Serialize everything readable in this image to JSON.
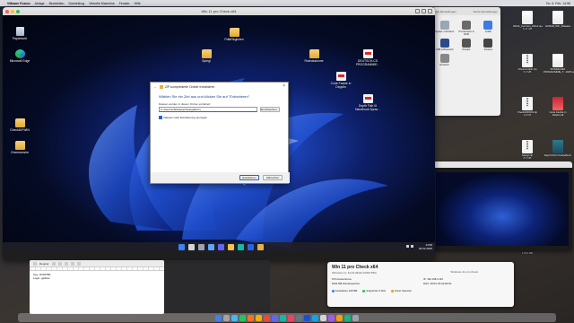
{
  "menubar": {
    "app": "VMware Fusion",
    "items": [
      "Ablage",
      "Bearbeiten",
      "Darstellung",
      "Virtuelle Maschine",
      "Fenster",
      "Hilfe"
    ],
    "clock": "Do. 6. Feb. 14:56"
  },
  "vm": {
    "title": "Win 11 pro Check x64",
    "desktop_icons": [
      {
        "label": "Papierkorb",
        "type": "bin"
      },
      {
        "label": "Microsoft Edge",
        "type": "edge"
      },
      {
        "label": "CheckDIFWIN",
        "type": "folder"
      },
      {
        "label": "Cheemzeshe",
        "type": "folder"
      },
      {
        "label": "PdfaRegisiren",
        "type": "folder"
      },
      {
        "label": "Spiegl",
        "type": "folder"
      },
      {
        "label": "Rubrokalonne",
        "type": "folder"
      },
      {
        "label": "DEUTSCH-CS PROGRAMMIE...",
        "type": "pdf"
      },
      {
        "label": "Code Fackte in Depplin",
        "type": "pdf"
      },
      {
        "label": "Depth Fish III Handbook Sprac...",
        "type": "pdf"
      }
    ],
    "taskbar_time": "14:56",
    "taskbar_date": "06.02.2025"
  },
  "zip_dialog": {
    "window_title": "ZIP-komprimierte Ordner extrahieren",
    "heading": "Wählen Sie ein Ziel aus und klicken Sie auf \"Extrahieren\".",
    "label": "Dateien werden in diesen Ordner extrahiert:",
    "path_value": "C:\\Users\\Gl\\Desktop\\Spiegelkorrs",
    "browse_label": "Durchsuchen...",
    "checkbox_label": "Dateien nach Extrahierung anzeigen",
    "extract_label": "Extrahieren",
    "cancel_label": "Abbrechen"
  },
  "prefs": {
    "header_left": "Alle Einstellungen",
    "header_right": "Suche Einstellungen",
    "items": [
      "Syntax- und Menü",
      "Prozessoren & RAM",
      "Grafik",
      "USB & Bluetooth",
      "Drucker",
      "Kamera",
      "Erweitert"
    ]
  },
  "mac_files": [
    {
      "name": "Win11_German_x64v1.iso",
      "sub": "5,47 GB"
    },
    {
      "name": "SONAR_Win_Release",
      "sub": ""
    },
    {
      "name": "Chemcombin.zip",
      "sub": "5,3 MB"
    },
    {
      "name": "SONAR-DEX PROGRAMMIE_T...2025.pdf",
      "sub": ""
    },
    {
      "name": "CheckDIFWIN.zip",
      "sub": "9,8 KB"
    },
    {
      "name": "Code Fackte in Delphi.pdf",
      "sub": ""
    },
    {
      "name": "Spiegl.zip",
      "sub": "8,4 MB"
    },
    {
      "name": "Depth Fish III Handbuch",
      "sub": ""
    },
    {
      "name": "PdfaRegisiren.zip",
      "sub": "9 MB"
    },
    {
      "name": "Rubrokalonne.zip",
      "sub": "178,6 MB"
    }
  ],
  "vm2": {
    "title": "Windows 11 pro Check"
  },
  "info": {
    "title": "Win 11 pro Check x64",
    "subtitle": "Windows 11, 64-bit  (Build 22000.556)",
    "right_label": "Windows 11 pro Check",
    "rows": [
      {
        "k": "8 Prozessorkerne",
        "v": "IP: 192.168.0.116"
      },
      {
        "k": "8192 MB Arbeitsspeicher",
        "v": "MAC: 00:0C:29:A3:D6:91"
      }
    ],
    "status": [
      {
        "label": "Festplatten 128 MB",
        "color": "#3b82f6"
      },
      {
        "label": "Snapshots 3 Stck",
        "color": "#22c55e"
      },
      {
        "label": "Freier Speicher",
        "color": "#f59e0b"
      }
    ]
  },
  "editor": {
    "toolbar_text": "Regular",
    "lines": [
      "Key: OOM7BF",
      "Login: gelluke"
    ]
  }
}
